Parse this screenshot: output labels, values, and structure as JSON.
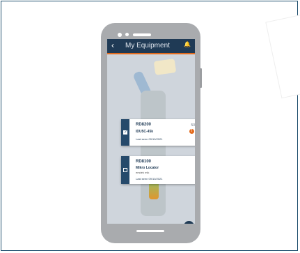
{
  "app": {
    "title": "My Equipment",
    "back_icon": "chevron-left-icon",
    "bell_icon": "bell-icon",
    "add_icon": "plus-icon"
  },
  "equipment": [
    {
      "model": "RD8200",
      "name": "IDU5C-45k",
      "status": "50",
      "last_seen": "Last seen 09/10/2021",
      "selected": true,
      "warning": "!"
    },
    {
      "model": "RD8100",
      "name": "Mikro Locator",
      "sub": "emdek mik",
      "last_seen": "Last seen 09/10/2021",
      "selected": false
    }
  ],
  "colors": {
    "appbar": "#1f3a55",
    "accent": "#e36b1d",
    "card_tab": "#264a6b"
  }
}
